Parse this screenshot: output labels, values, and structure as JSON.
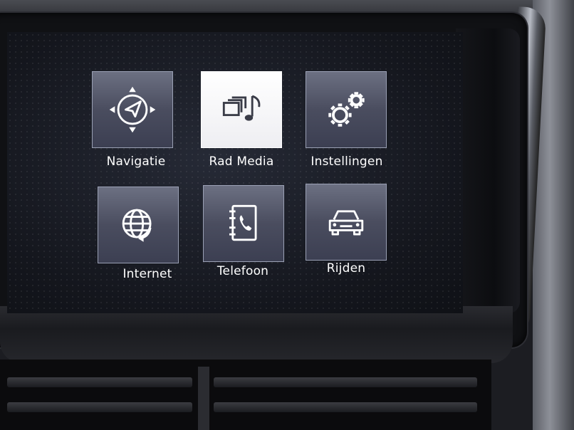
{
  "screen": {
    "accent": "#6c7082",
    "tiles": [
      {
        "label": "Navigatie",
        "icon": "navigation-compass-icon",
        "active": false
      },
      {
        "label": "Rad Media",
        "icon": "media-music-icon",
        "active": true
      },
      {
        "label": "Instellingen",
        "icon": "settings-gears-icon",
        "active": false
      },
      {
        "label": "Internet",
        "icon": "internet-globe-icon",
        "active": false
      },
      {
        "label": "Telefoon",
        "icon": "phone-book-icon",
        "active": false
      },
      {
        "label": "Rijden",
        "icon": "car-icon",
        "active": false
      }
    ]
  }
}
